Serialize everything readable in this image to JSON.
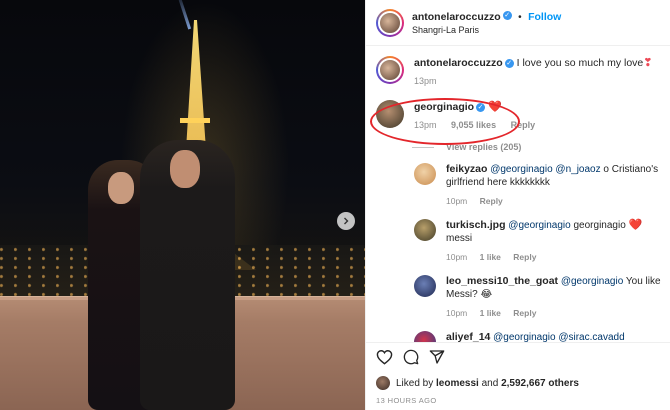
{
  "post": {
    "author": "antonelaroccuzzo",
    "follow_label": "Follow",
    "location": "Shangri-La Paris",
    "caption": {
      "username": "antonelaroccuzzo",
      "text": "I love you so much my love",
      "time": "13pm"
    }
  },
  "comments": [
    {
      "username": "georginagio",
      "time": "13pm",
      "likes": "9,055 likes",
      "reply_label": "Reply",
      "view_replies": "View replies (205)"
    }
  ],
  "replies": [
    {
      "username": "feikyzao",
      "mentions": "@georginagio @n_joaoz",
      "text": "o Cristiano's girlfriend here kkkkkkkk",
      "time": "10pm",
      "reply_label": "Reply"
    },
    {
      "username": "turkisch.jpg",
      "mentions": "@georginagio",
      "text": "georginagio",
      "text_after": "messi",
      "time": "10pm",
      "likes": "1 like",
      "reply_label": "Reply"
    },
    {
      "username": "leo_messi10_the_goat",
      "mentions": "@georginagio",
      "text": "You like Messi?",
      "emoji": "😂",
      "time": "10pm",
      "likes": "1 like",
      "reply_label": "Reply"
    },
    {
      "username": "aliyef_14",
      "mentions": "@georginagio @sirac.cavadd"
    }
  ],
  "footer": {
    "liked_by_prefix": "Liked by",
    "liked_by_user": "leomessi",
    "liked_by_and": "and",
    "others": "2,592,667 others",
    "time_ago": "13 HOURS AGO"
  },
  "colors": {
    "accent_blue": "#0095f6",
    "verified_blue": "#3897f0",
    "heart_red": "#ed4956",
    "highlight_red": "#e3262b"
  },
  "icons": [
    "chevron-right-icon",
    "verified-icon",
    "heart-icon",
    "comment-icon",
    "share-icon"
  ]
}
